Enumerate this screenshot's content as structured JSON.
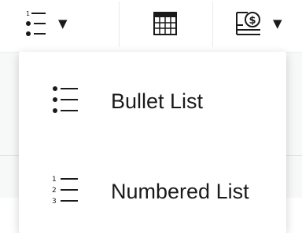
{
  "toolbar": {
    "list_button": {
      "icon": "numbered-list-icon",
      "caret": "▼"
    },
    "table_button": {
      "icon": "table-grid-icon"
    },
    "money_button": {
      "icon": "currency-document-icon",
      "caret": "▼"
    }
  },
  "list_menu": {
    "items": [
      {
        "label": "Bullet List",
        "icon": "bullet-list-icon"
      },
      {
        "label": "Numbered List",
        "icon": "numbered-list-icon",
        "markers": [
          "1",
          "2",
          "3"
        ]
      }
    ]
  },
  "colors": {
    "text": "#1a1a1a",
    "separator": "#e7eaec",
    "background": "#f7f8f8"
  }
}
